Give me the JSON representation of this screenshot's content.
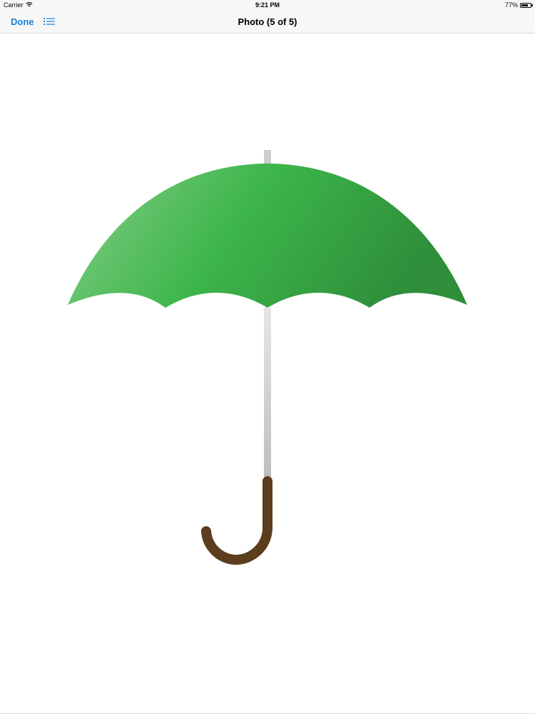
{
  "status_bar": {
    "carrier": "Carrier",
    "time": "9:21 PM",
    "battery_text": "77%",
    "battery_level": 0.77,
    "wifi_icon": "wifi-icon",
    "battery_icon": "battery-icon"
  },
  "nav_bar": {
    "done_label": "Done",
    "list_icon": "list-icon",
    "title": "Photo (5 of 5)",
    "accent_color": "#1a7fd4"
  },
  "photo": {
    "subject": "umbrella-image",
    "canopy_color": "#3cb54a",
    "handle_color": "#5c3d1e",
    "shaft_color": "#cccccc"
  }
}
